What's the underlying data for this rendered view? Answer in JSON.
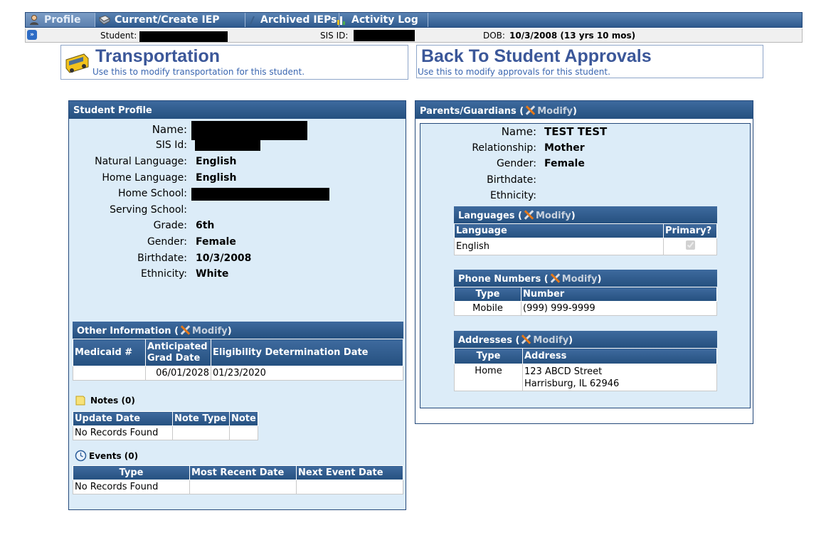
{
  "tabs": [
    {
      "label": "Profile",
      "icon": "user-icon"
    },
    {
      "label": "Current/Create IEP",
      "icon": "book-icon"
    },
    {
      "label": "Archived IEPs",
      "icon": "pencil-icon"
    },
    {
      "label": "Activity Log",
      "icon": "chart-icon"
    }
  ],
  "infobar": {
    "student_label": "Student:",
    "sis_label": "SIS ID:",
    "dob_label": "DOB:",
    "dob_value": "10/3/2008 (13 yrs 10 mos)"
  },
  "actions": {
    "transportation": {
      "title": "Transportation",
      "subtitle": "Use this to modify transportation for this student."
    },
    "approvals": {
      "title": "Back To Student Approvals",
      "subtitle": "Use this to modify approvals for this student."
    }
  },
  "student_profile": {
    "title": "Student Profile",
    "fields": [
      {
        "label": "Name:",
        "value": ""
      },
      {
        "label": "SIS Id:",
        "value": ""
      },
      {
        "label": "Natural Language:",
        "value": "English"
      },
      {
        "label": "Home Language:",
        "value": "English"
      },
      {
        "label": "Home School:",
        "value": ""
      },
      {
        "label": "Serving School:",
        "value": ""
      },
      {
        "label": "Grade:",
        "value": "6th"
      },
      {
        "label": "Gender:",
        "value": "Female"
      },
      {
        "label": "Birthdate:",
        "value": "10/3/2008"
      },
      {
        "label": "Ethnicity:",
        "value": "White"
      }
    ],
    "other_info": {
      "title": "Other Information",
      "modify": "Modify",
      "headers": [
        "Medicaid #",
        "Anticipated Grad Date",
        "Eligibility Determination Date"
      ],
      "header_line1": "Anticipated",
      "header_line2": "Grad Date",
      "row": [
        "",
        "06/01/2028",
        "01/23/2020"
      ]
    },
    "notes": {
      "title": "Notes (0)",
      "headers": [
        "Update Date",
        "Note Type",
        "Note"
      ],
      "empty": "No Records Found"
    },
    "events": {
      "title": "Events (0)",
      "headers": [
        "Type",
        "Most Recent Date",
        "Next Event Date"
      ],
      "empty": "No Records Found"
    }
  },
  "guardians": {
    "title": "Parents/Guardians",
    "modify": "Modify",
    "fields": [
      {
        "label": "Name:",
        "value": "TEST TEST"
      },
      {
        "label": "Relationship:",
        "value": "Mother"
      },
      {
        "label": "Gender:",
        "value": "Female"
      },
      {
        "label": "Birthdate:",
        "value": ""
      },
      {
        "label": "Ethnicity:",
        "value": ""
      }
    ],
    "languages": {
      "title": "Languages",
      "modify": "Modify",
      "headers": [
        "Language",
        "Primary?"
      ],
      "rows": [
        {
          "language": "English",
          "primary": true
        }
      ]
    },
    "phones": {
      "title": "Phone Numbers",
      "modify": "Modify",
      "headers": [
        "Type",
        "Number"
      ],
      "rows": [
        {
          "type": "Mobile",
          "number": "(999) 999-9999"
        }
      ]
    },
    "addresses": {
      "title": "Addresses",
      "modify": "Modify",
      "headers": [
        "Type",
        "Address"
      ],
      "rows": [
        {
          "type": "Home",
          "line1": "123 ABCD Street",
          "line2": "Harrisburg, IL 62946"
        }
      ]
    }
  },
  "colors": {
    "header_blue": "#2f5a8e",
    "panel_bg": "#dcecf8",
    "title_blue": "#3b5799",
    "link_blue": "#3a66b0",
    "wrench_orange": "#e3781a"
  }
}
